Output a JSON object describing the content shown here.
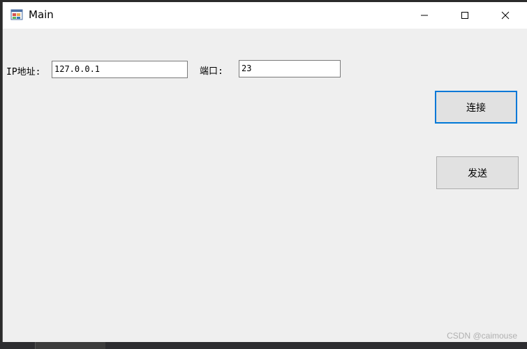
{
  "window": {
    "title": "Main",
    "icon": "winforms-app-icon"
  },
  "titlebar": {
    "minimize_icon": "minimize-icon",
    "maximize_icon": "maximize-icon",
    "close_icon": "close-icon"
  },
  "form": {
    "ip_label": "IP地址:",
    "ip_value": "127.0.0.1",
    "port_label": "端口:",
    "port_value": "23",
    "connect_label": "连接",
    "send_label": "发送"
  },
  "watermark": "CSDN @caimouse",
  "colors": {
    "focus_border": "#0078d7",
    "form_background": "#efefef",
    "button_background": "#e1e1e1"
  }
}
